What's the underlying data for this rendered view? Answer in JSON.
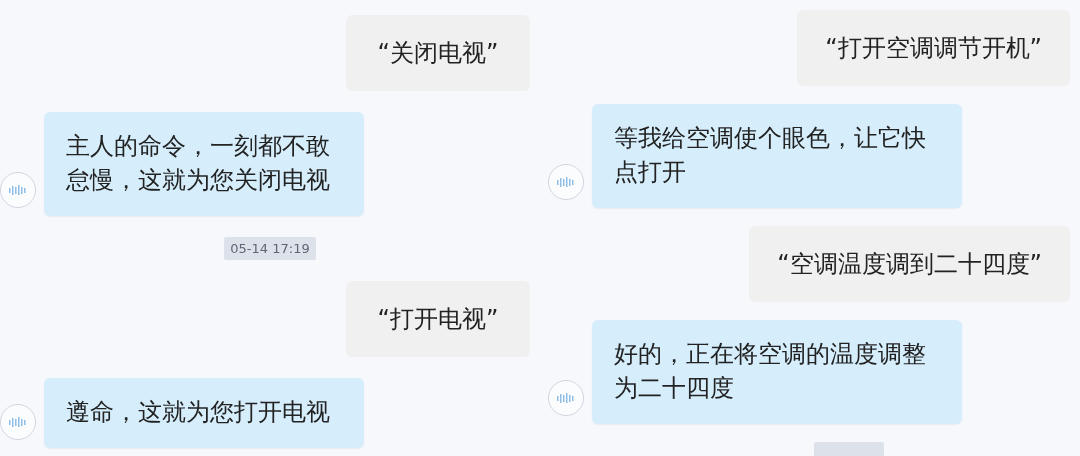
{
  "panels": [
    {
      "messages": [
        {
          "kind": "user",
          "text": "“关闭电视”"
        },
        {
          "kind": "bot",
          "text": "主人的命令，一刻都不敢怠慢，这就为您关闭电视"
        },
        {
          "kind": "time",
          "text": "05-14 17:19"
        },
        {
          "kind": "user",
          "text": "“打开电视”"
        },
        {
          "kind": "bot",
          "text": "遵命，这就为您打开电视"
        }
      ]
    },
    {
      "messages": [
        {
          "kind": "user",
          "text": "“打开空调调节开机”"
        },
        {
          "kind": "bot",
          "text": "等我给空调使个眼色，让它快点打开"
        },
        {
          "kind": "user",
          "text": "“空调温度调到二十四度”"
        },
        {
          "kind": "bot",
          "text": "好的，正在将空调的温度调整为二十四度"
        },
        {
          "kind": "time_cut"
        }
      ]
    }
  ]
}
